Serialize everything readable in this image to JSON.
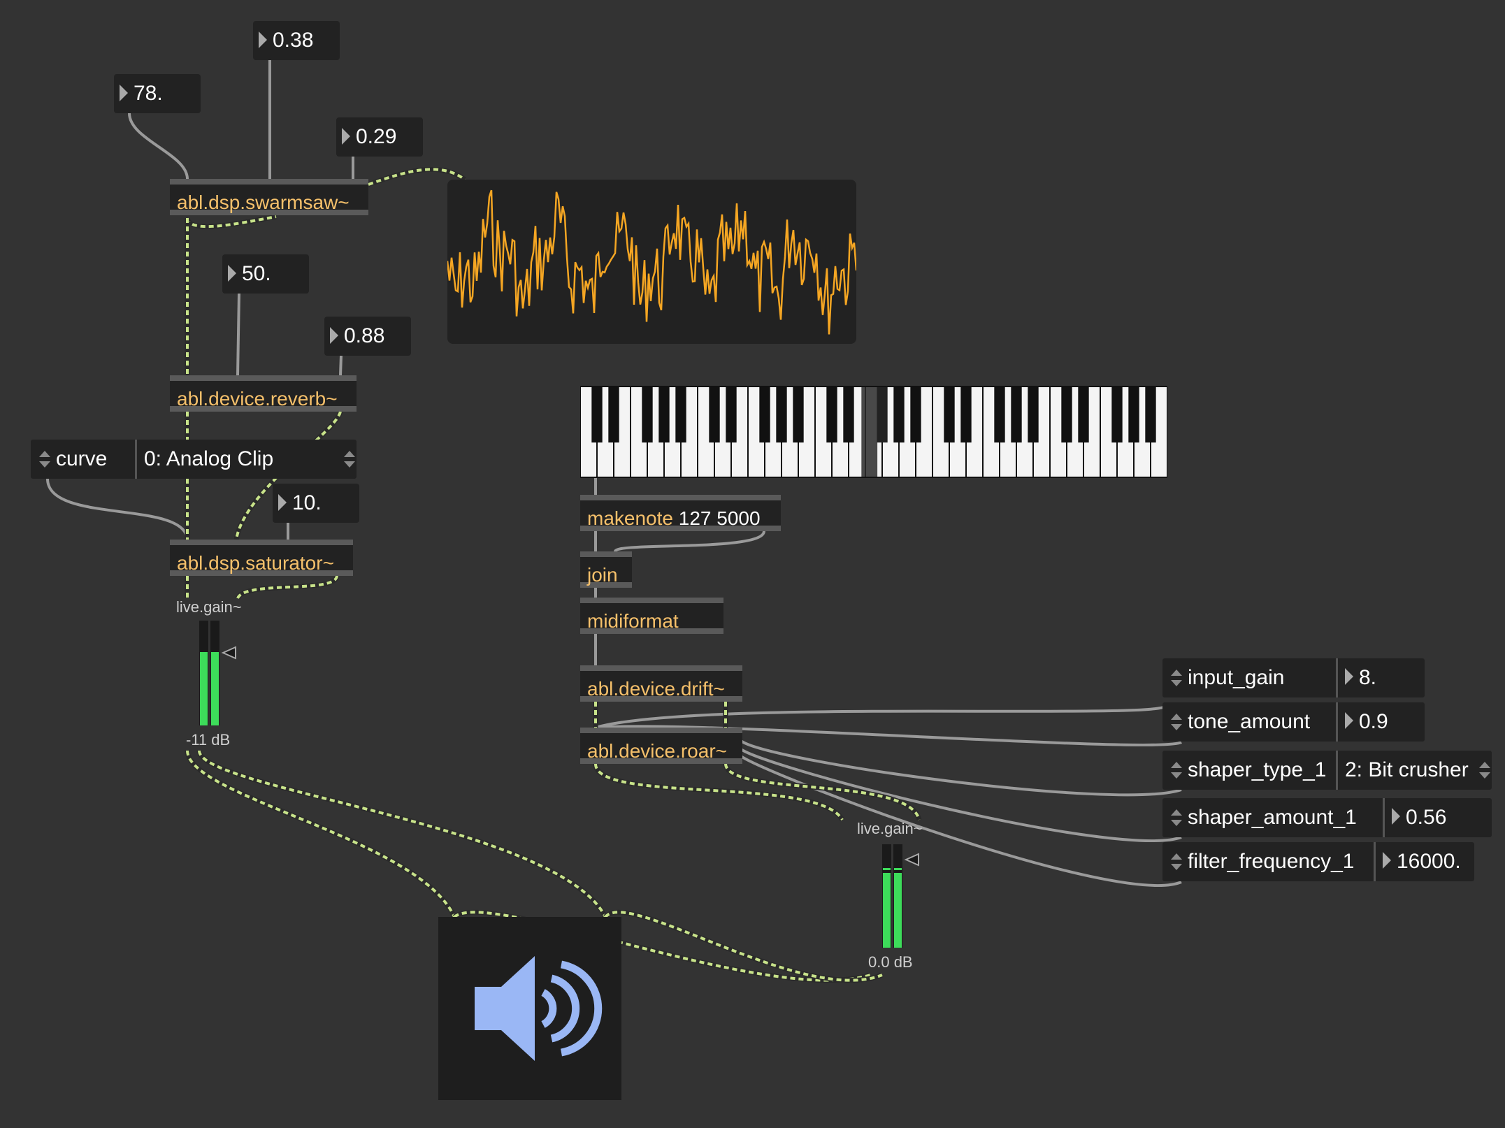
{
  "numbers": {
    "n038": "0.38",
    "n78": "78.",
    "n029": "0.29",
    "n50": "50.",
    "n088": "0.88",
    "n10": "10."
  },
  "objects": {
    "swarmsaw": "abl.dsp.swarmsaw~",
    "reverb": "abl.device.reverb~",
    "saturator": "abl.dsp.saturator~",
    "makenote": "makenote",
    "makenote_args": "127 5000",
    "join": "join",
    "midiformat": "midiformat",
    "drift": "abl.device.drift~",
    "roar": "abl.device.roar~"
  },
  "curve_menu": {
    "label": "curve",
    "value": "0: Analog Clip"
  },
  "params": [
    {
      "label": "input_gain",
      "value": "8."
    },
    {
      "label": "tone_amount",
      "value": "0.9"
    },
    {
      "label": "shaper_type_1",
      "value": "2: Bit crusher"
    },
    {
      "label": "shaper_amount_1",
      "value": "0.56"
    },
    {
      "label": "filter_frequency_1",
      "value": "16000."
    }
  ],
  "gain_left": {
    "name": "live.gain~",
    "readout": "-11 dB",
    "level": 0.7
  },
  "gain_right": {
    "name": "live.gain~",
    "readout": "0.0 dB",
    "level": 0.72
  },
  "icons": {
    "speaker": "speaker-volume-icon",
    "stepper": "up-down-arrows-icon",
    "number_arrow": "right-triangle-icon"
  },
  "colors": {
    "background": "#333333",
    "object_text": "#f5c06b",
    "scope_wave": "#f5a623",
    "signal_cord": "#c8e38a",
    "meter": "#3ddc5a",
    "speaker": "#9ab7f5"
  },
  "piano": {
    "octaves": 5,
    "highlighted_black_key": "F#"
  }
}
